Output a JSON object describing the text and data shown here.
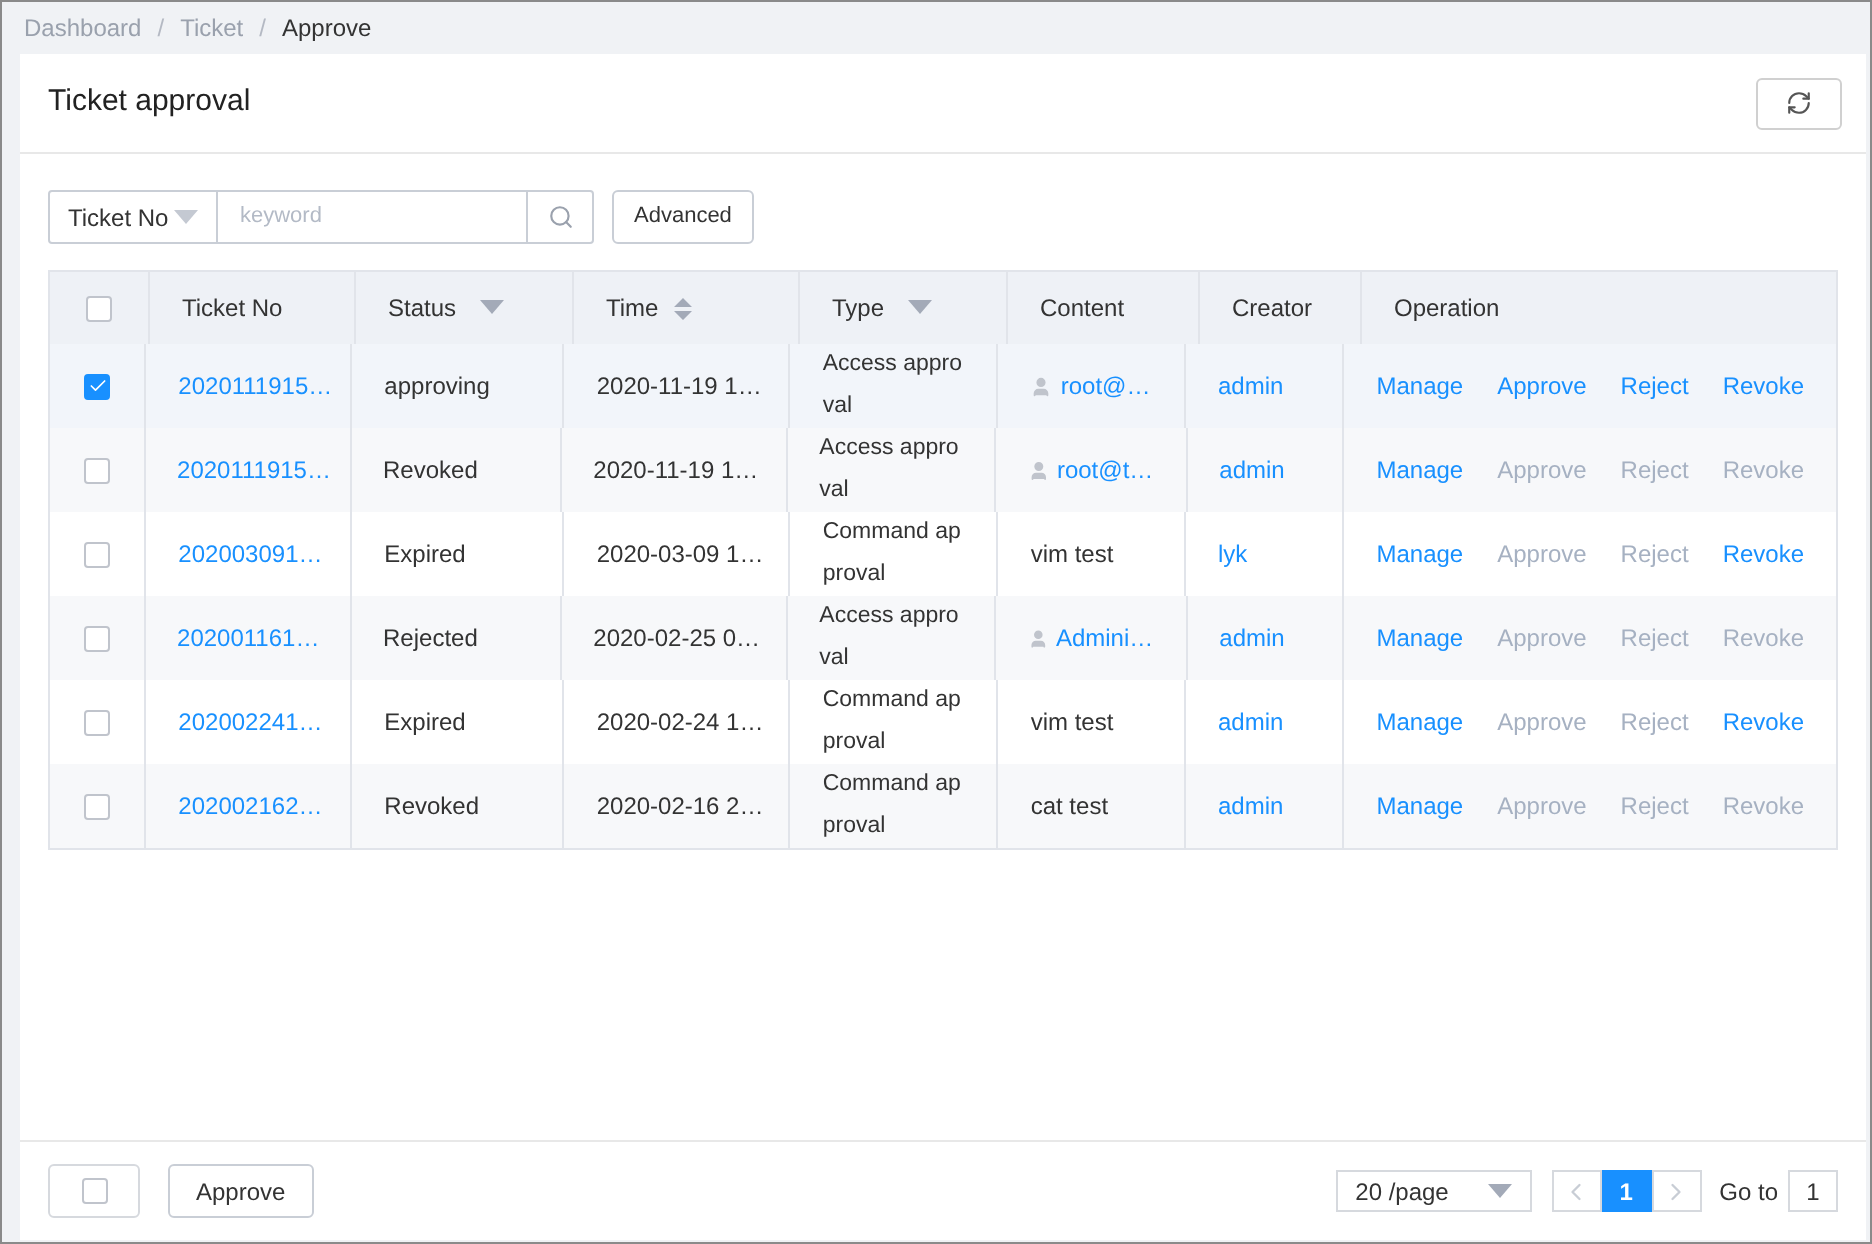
{
  "breadcrumb": [
    {
      "label": "Dashboard",
      "current": false
    },
    {
      "separator": "/"
    },
    {
      "label": "Ticket",
      "current": false
    },
    {
      "separator": "/"
    },
    {
      "label": "Approve",
      "current": true
    }
  ],
  "title": "Ticket approval",
  "search": {
    "field": "Ticket No",
    "placeholder": "keyword",
    "advanced": "Advanced"
  },
  "table": {
    "all_checked": false,
    "columns": [
      {
        "label": "Ticket No",
        "kind": "plain"
      },
      {
        "label": "Status",
        "kind": "filter"
      },
      {
        "label": "Time",
        "kind": "sort"
      },
      {
        "label": "Type",
        "kind": "filter"
      },
      {
        "label": "Content",
        "kind": "plain"
      },
      {
        "label": "Creator",
        "kind": "plain"
      },
      {
        "label": "Operation",
        "kind": "plain"
      }
    ],
    "rows": [
      {
        "selected": true,
        "ticket": "2020111915…",
        "status": "approving",
        "time": "2020-11-19 1…",
        "type": "Access approval",
        "content": {
          "kind": "user",
          "text": "root@…"
        },
        "creator": "admin",
        "operations": [
          {
            "label": "Manage",
            "disabled": false
          },
          {
            "label": "Approve",
            "disabled": false
          },
          {
            "label": "Reject",
            "disabled": false
          },
          {
            "label": "Revoke",
            "disabled": false
          }
        ]
      },
      {
        "selected": false,
        "ticket": "2020111915…",
        "status": "Revoked",
        "time": "2020-11-19 1…",
        "type": "Access approval",
        "content": {
          "kind": "user",
          "text": "root@t…"
        },
        "creator": "admin",
        "operations": [
          {
            "label": "Manage",
            "disabled": false
          },
          {
            "label": "Approve",
            "disabled": true
          },
          {
            "label": "Reject",
            "disabled": true
          },
          {
            "label": "Revoke",
            "disabled": true
          }
        ]
      },
      {
        "selected": false,
        "ticket": "202003091…",
        "status": "Expired",
        "time": "2020-03-09 1…",
        "type": "Command approval",
        "content": {
          "kind": "text",
          "text": "vim test"
        },
        "creator": "lyk",
        "operations": [
          {
            "label": "Manage",
            "disabled": false
          },
          {
            "label": "Approve",
            "disabled": true
          },
          {
            "label": "Reject",
            "disabled": true
          },
          {
            "label": "Revoke",
            "disabled": false
          }
        ]
      },
      {
        "selected": false,
        "ticket": "202001161…",
        "status": "Rejected",
        "time": "2020-02-25 0…",
        "type": "Access approval",
        "content": {
          "kind": "user",
          "text": "Admini…"
        },
        "creator": "admin",
        "operations": [
          {
            "label": "Manage",
            "disabled": false
          },
          {
            "label": "Approve",
            "disabled": true
          },
          {
            "label": "Reject",
            "disabled": true
          },
          {
            "label": "Revoke",
            "disabled": true
          }
        ]
      },
      {
        "selected": false,
        "ticket": "202002241…",
        "status": "Expired",
        "time": "2020-02-24 1…",
        "type": "Command approval",
        "content": {
          "kind": "text",
          "text": "vim test"
        },
        "creator": "admin",
        "operations": [
          {
            "label": "Manage",
            "disabled": false
          },
          {
            "label": "Approve",
            "disabled": true
          },
          {
            "label": "Reject",
            "disabled": true
          },
          {
            "label": "Revoke",
            "disabled": false
          }
        ]
      },
      {
        "selected": false,
        "ticket": "202002162…",
        "status": "Revoked",
        "time": "2020-02-16 2…",
        "type": "Command approval",
        "content": {
          "kind": "text",
          "text": "cat test"
        },
        "creator": "admin",
        "operations": [
          {
            "label": "Manage",
            "disabled": false
          },
          {
            "label": "Approve",
            "disabled": true
          },
          {
            "label": "Reject",
            "disabled": true
          },
          {
            "label": "Revoke",
            "disabled": true
          }
        ]
      }
    ]
  },
  "footer": {
    "select_all_checked": false,
    "approve": "Approve"
  },
  "pagination": {
    "page_size": "20 /page",
    "pages": [
      {
        "label": "1",
        "selected": true
      }
    ],
    "goto_label": "Go to",
    "goto_value": "1"
  }
}
